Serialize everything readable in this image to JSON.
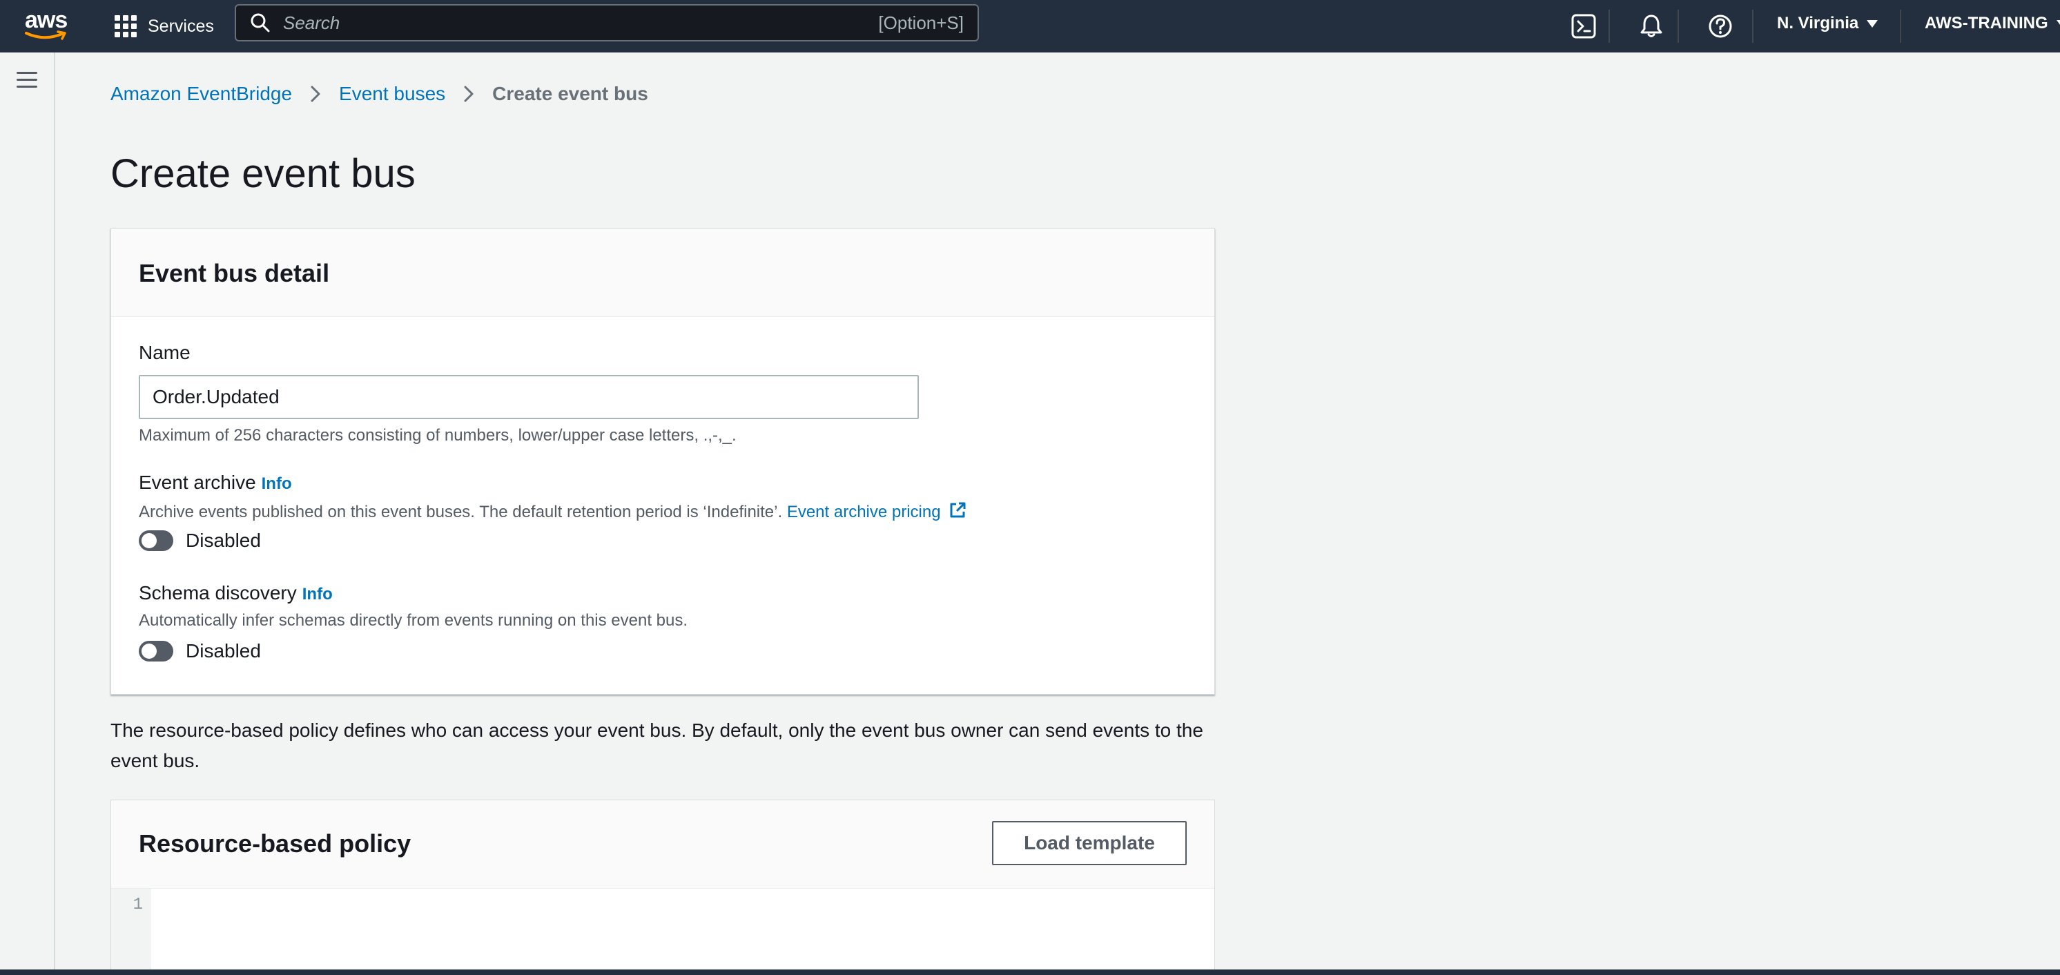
{
  "topnav": {
    "logo_text": "aws",
    "services_label": "Services",
    "search_placeholder": "Search",
    "search_shortcut": "[Option+S]",
    "region_label": "N. Virginia",
    "account_label": "AWS-TRAINING"
  },
  "breadcrumb": {
    "items": [
      "Amazon EventBridge",
      "Event buses"
    ],
    "current": "Create event bus"
  },
  "page": {
    "title": "Create event bus"
  },
  "event_bus_detail": {
    "header": "Event bus detail",
    "name_label": "Name",
    "name_value": "Order.Updated",
    "name_hint": "Maximum of 256 characters consisting of numbers, lower/upper case letters, .,-,_.",
    "archive_label": "Event archive",
    "archive_info": "Info",
    "archive_desc": "Archive events published on this event buses. The default retention period is ‘Indefinite’.",
    "archive_link": "Event archive pricing",
    "archive_toggle_label": "Disabled",
    "schema_label": "Schema discovery",
    "schema_info": "Info",
    "schema_desc": "Automatically infer schemas directly from events running on this event bus.",
    "schema_toggle_label": "Disabled"
  },
  "policy": {
    "description": "The resource-based policy defines who can access your event bus. By default, only the event bus owner can send events to the event bus.",
    "header": "Resource-based policy",
    "load_template_label": "Load template",
    "line_numbers": [
      "1"
    ]
  },
  "colors": {
    "nav_bg": "#232f3e",
    "link": "#0073bb",
    "page_bg": "#f2f3f3"
  }
}
